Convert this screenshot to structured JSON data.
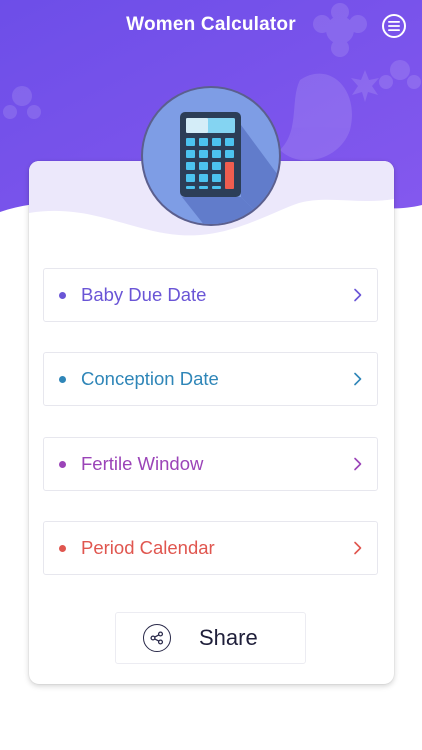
{
  "header": {
    "title": "Women Calculator",
    "menu_icon": "hamburger-menu-icon",
    "background_color": "#7752ec"
  },
  "logo": {
    "icon": "calculator-icon"
  },
  "menu": {
    "items": [
      {
        "label": "Baby Due Date",
        "color": "#6a55d6"
      },
      {
        "label": "Conception Date",
        "color": "#2f86b8"
      },
      {
        "label": "Fertile Window",
        "color": "#9b44b8"
      },
      {
        "label": "Period Calendar",
        "color": "#e0564f"
      }
    ]
  },
  "share": {
    "label": "Share",
    "icon": "share-icon"
  }
}
